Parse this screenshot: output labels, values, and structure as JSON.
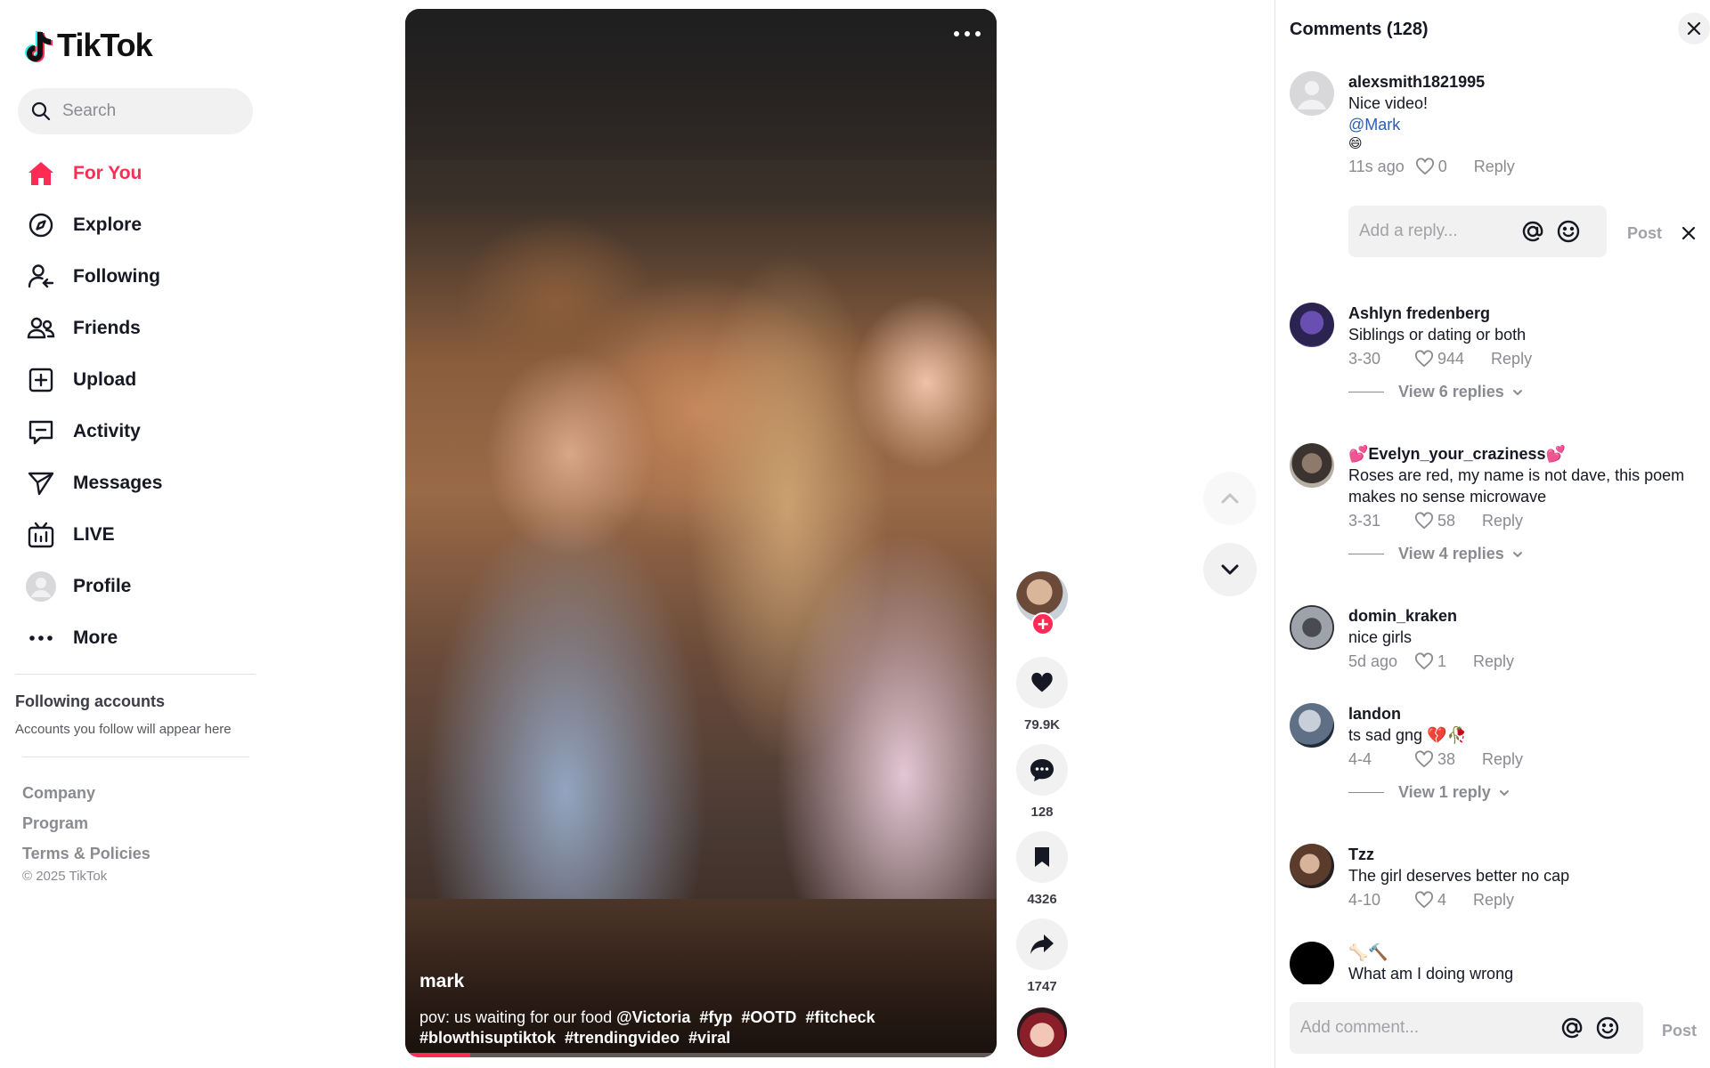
{
  "brand": {
    "name": "TikTok",
    "accent": "#fe2c55"
  },
  "search": {
    "placeholder": "Search"
  },
  "nav": [
    {
      "label": "For You",
      "icon": "home-icon",
      "active": true
    },
    {
      "label": "Explore",
      "icon": "compass-icon"
    },
    {
      "label": "Following",
      "icon": "following-icon"
    },
    {
      "label": "Friends",
      "icon": "friends-icon"
    },
    {
      "label": "Upload",
      "icon": "upload-icon"
    },
    {
      "label": "Activity",
      "icon": "activity-icon"
    },
    {
      "label": "Messages",
      "icon": "messages-icon"
    },
    {
      "label": "LIVE",
      "icon": "live-icon"
    },
    {
      "label": "Profile",
      "icon": "profile-avatar"
    },
    {
      "label": "More",
      "icon": "more-icon"
    }
  ],
  "following": {
    "title": "Following accounts",
    "subtitle": "Accounts you follow will appear here"
  },
  "footer": {
    "links": [
      "Company",
      "Program",
      "Terms & Policies"
    ],
    "copyright": "© 2025 TikTok"
  },
  "video": {
    "author": "mark",
    "description_prefix": "pov: us waiting for our food ",
    "mention": "@Victoria",
    "hashtags_line1": [
      "#fyp",
      "#OOTD",
      "#fitcheck"
    ],
    "hashtags_line2": [
      "#blowthisuptiktok",
      "#trendingvideo",
      "#viral"
    ],
    "progress": 0.11
  },
  "actions": {
    "likes": "79.9K",
    "comments": "128",
    "saves": "4326",
    "shares": "1747"
  },
  "comments_panel": {
    "title": "Comments (128)",
    "reply_placeholder": "Add a reply...",
    "reply_post": "Post",
    "add_placeholder": "Add comment...",
    "add_post": "Post",
    "items": [
      {
        "user": "alexsmith1821995",
        "text": "Nice video!",
        "mention": "@Mark",
        "emoji": "😄",
        "time": "11s ago",
        "likes": "0",
        "reply": "Reply"
      },
      {
        "user": "Ashlyn fredenberg",
        "text": "Siblings or dating or both",
        "time": "3-30",
        "likes": "944",
        "reply": "Reply",
        "view_replies": "View 6 replies"
      },
      {
        "user": "💕Evelyn_your_craziness💕",
        "text": "Roses are red, my name is not dave, this poem makes no sense microwave",
        "time": "3-31",
        "likes": "58",
        "reply": "Reply",
        "view_replies": "View 4 replies"
      },
      {
        "user": "domin_kraken",
        "text": "nice girls",
        "time": "5d ago",
        "likes": "1",
        "reply": "Reply"
      },
      {
        "user": "landon",
        "text": "ts sad gng 💔🥀",
        "time": "4-4",
        "likes": "38",
        "reply": "Reply",
        "view_replies": "View 1 reply"
      },
      {
        "user": "Tzz",
        "text": "The girl deserves better no cap",
        "time": "4-10",
        "likes": "4",
        "reply": "Reply"
      },
      {
        "user": "🦴🔨",
        "text": "What am I doing wrong"
      }
    ]
  }
}
